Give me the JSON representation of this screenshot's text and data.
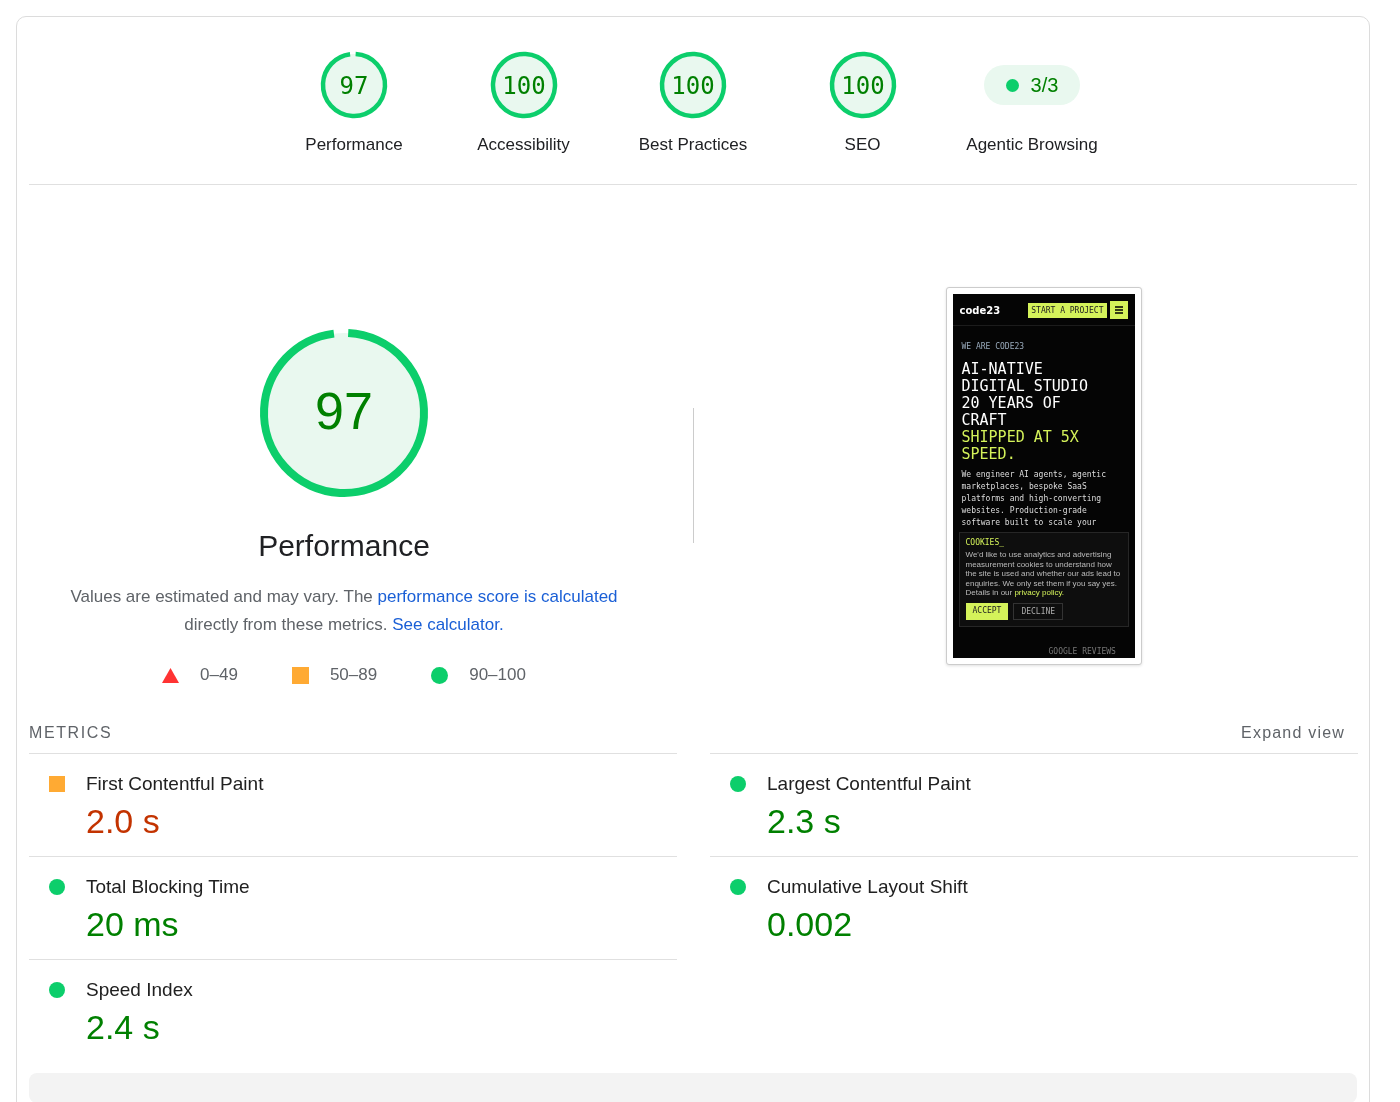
{
  "categories": [
    {
      "kind": "gauge",
      "score": "97",
      "level": 0.97,
      "label": "Performance"
    },
    {
      "kind": "gauge",
      "score": "100",
      "level": 1,
      "label": "Accessibility"
    },
    {
      "kind": "gauge",
      "score": "100",
      "level": 1,
      "label": "Best Practices"
    },
    {
      "kind": "gauge",
      "score": "100",
      "level": 1,
      "label": "SEO"
    },
    {
      "kind": "pill",
      "score": "3/3",
      "label": "Agentic Browsing"
    }
  ],
  "main_gauge": {
    "score": "97",
    "level": 0.97,
    "title": "Performance"
  },
  "description": [
    {
      "kind": "text",
      "text": "Values are estimated and may vary. The "
    },
    {
      "kind": "link",
      "text": "performance score is"
    },
    {
      "kind": "link",
      "text": "calculated"
    },
    {
      "kind": "text",
      "text": " directly from these metrics. "
    },
    {
      "kind": "link",
      "text": "See calculator."
    }
  ],
  "legend": [
    {
      "kind": "fail",
      "label": "0–49"
    },
    {
      "kind": "average",
      "label": "50–89"
    },
    {
      "kind": "pass",
      "label": "90–100"
    }
  ],
  "screenshot": {
    "logo": "code23",
    "cta": "START A PROJECT",
    "eyebrow": "WE ARE CODE23",
    "headline": [
      {
        "text": "AI-NATIVE",
        "highlight": false
      },
      {
        "text": "DIGITAL STUDIO",
        "highlight": false
      },
      {
        "text": "20 YEARS OF",
        "highlight": false
      },
      {
        "text": "CRAFT",
        "highlight": false
      },
      {
        "text": "SHIPPED AT 5X",
        "highlight": true
      },
      {
        "text": "SPEED.",
        "highlight": true
      }
    ],
    "body": "We engineer AI agents, agentic marketplaces, bespoke SaaS platforms and high-converting websites. Production-grade software built to scale your",
    "cookie_title": "COOKIES_",
    "cookie_text": "We'd like to use analytics and advertising measurement cookies to understand how the site is used and whether our ads lead to enquiries. We only set them if you say yes. Details in our ",
    "cookie_link": "privacy policy.",
    "accept": "ACCEPT",
    "decline": "DECLINE",
    "footer": "GOOGLE REVIEWS"
  },
  "metrics_heading": "METRICS",
  "expand": "Expand view",
  "metrics": [
    {
      "name": "First Contentful Paint",
      "value": "2.0 s",
      "kind": "average"
    },
    {
      "name": "Largest Contentful Paint",
      "value": "2.3 s",
      "kind": "pass"
    },
    {
      "name": "Total Blocking Time",
      "value": "20 ms",
      "kind": "pass"
    },
    {
      "name": "Cumulative Layout Shift",
      "value": "0.002",
      "kind": "pass"
    },
    {
      "name": "Speed Index",
      "value": "2.4 s",
      "kind": "pass"
    }
  ]
}
